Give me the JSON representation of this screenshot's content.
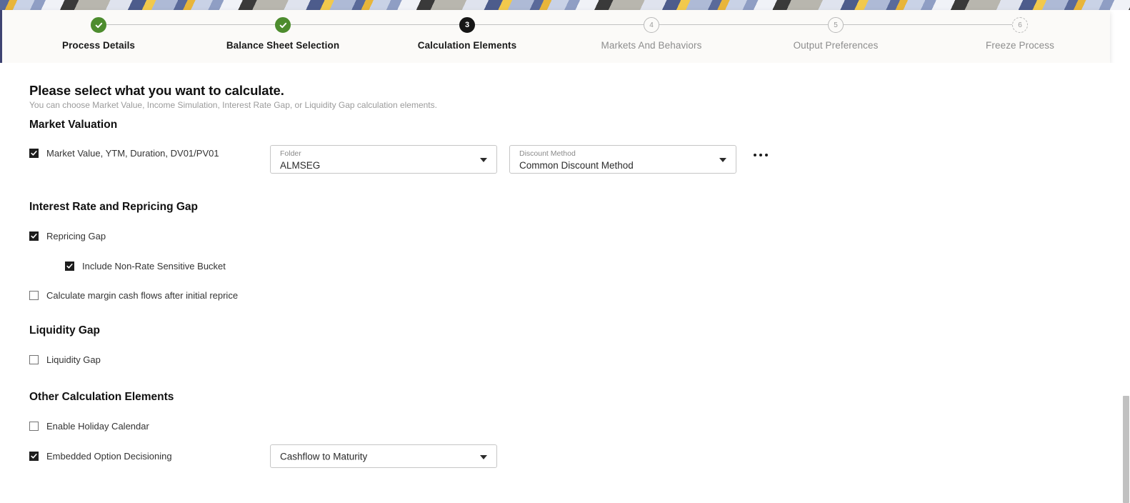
{
  "banner": {
    "name": "decorative-banner"
  },
  "stepper": {
    "steps": [
      {
        "number": "1",
        "label": "Process Details",
        "state": "done"
      },
      {
        "number": "2",
        "label": "Balance Sheet Selection",
        "state": "done"
      },
      {
        "number": "3",
        "label": "Calculation Elements",
        "state": "current"
      },
      {
        "number": "4",
        "label": "Markets And Behaviors",
        "state": "todo"
      },
      {
        "number": "5",
        "label": "Output Preferences",
        "state": "todo"
      },
      {
        "number": "6",
        "label": "Freeze Process",
        "state": "dashed"
      }
    ],
    "colors": {
      "done": "#4d8c2e",
      "current": "#161616",
      "todo": "#b9b9b9",
      "connector": "#c2c2c2"
    }
  },
  "main": {
    "title": "Please select what you want to calculate.",
    "subtitle": "You can choose Market Value, Income Simulation, Interest Rate Gap, or Liquidity Gap calculation elements.",
    "sections": {
      "market_valuation": {
        "heading": "Market Valuation",
        "checkbox": {
          "label": "Market Value, YTM, Duration, DV01/PV01",
          "checked": true
        },
        "folder_select": {
          "label": "Folder",
          "value": "ALMSEG"
        },
        "discount_select": {
          "label": "Discount Method",
          "value": "Common Discount Method"
        },
        "overflow_menu": "more-options"
      },
      "interest_rate_gap": {
        "heading": "Interest Rate and Repricing Gap",
        "checkboxes": [
          {
            "label": "Repricing Gap",
            "checked": true
          },
          {
            "label": "Include Non-Rate Sensitive Bucket",
            "checked": true
          },
          {
            "label": "Calculate margin cash flows after initial reprice",
            "checked": false
          }
        ]
      },
      "liquidity_gap": {
        "heading": "Liquidity Gap",
        "checkboxes": [
          {
            "label": "Liquidity Gap",
            "checked": false
          }
        ]
      },
      "other_elements": {
        "heading": "Other Calculation Elements",
        "checkboxes": [
          {
            "label": "Enable Holiday Calendar",
            "checked": false
          },
          {
            "label": "Embedded Option Decisioning",
            "checked": true
          }
        ],
        "embedded_option_select": {
          "value": "Cashflow to Maturity"
        }
      }
    }
  }
}
